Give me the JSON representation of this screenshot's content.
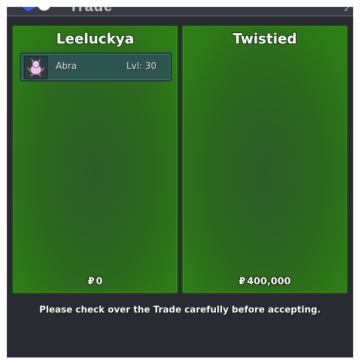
{
  "window": {
    "title": "Trade",
    "corner_glyph": "✓"
  },
  "left_panel": {
    "player_name": "Leeluckya",
    "currency_symbol": "₽",
    "money": "0",
    "pokemon": [
      {
        "name": "Abra",
        "level": "Lvl: 30",
        "icon": "abra-sprite-icon"
      }
    ]
  },
  "right_panel": {
    "player_name": "Twistied",
    "currency_symbol": "₽",
    "money": "400,000",
    "pokemon": []
  },
  "notice": "Please check over the Trade carefully before accepting.",
  "colors": {
    "panel_green": "#2c6a1d",
    "panel_border": "#1b4d10",
    "pokemon_row_bg": "#2e5450",
    "window_bg": "#2a2a33"
  }
}
